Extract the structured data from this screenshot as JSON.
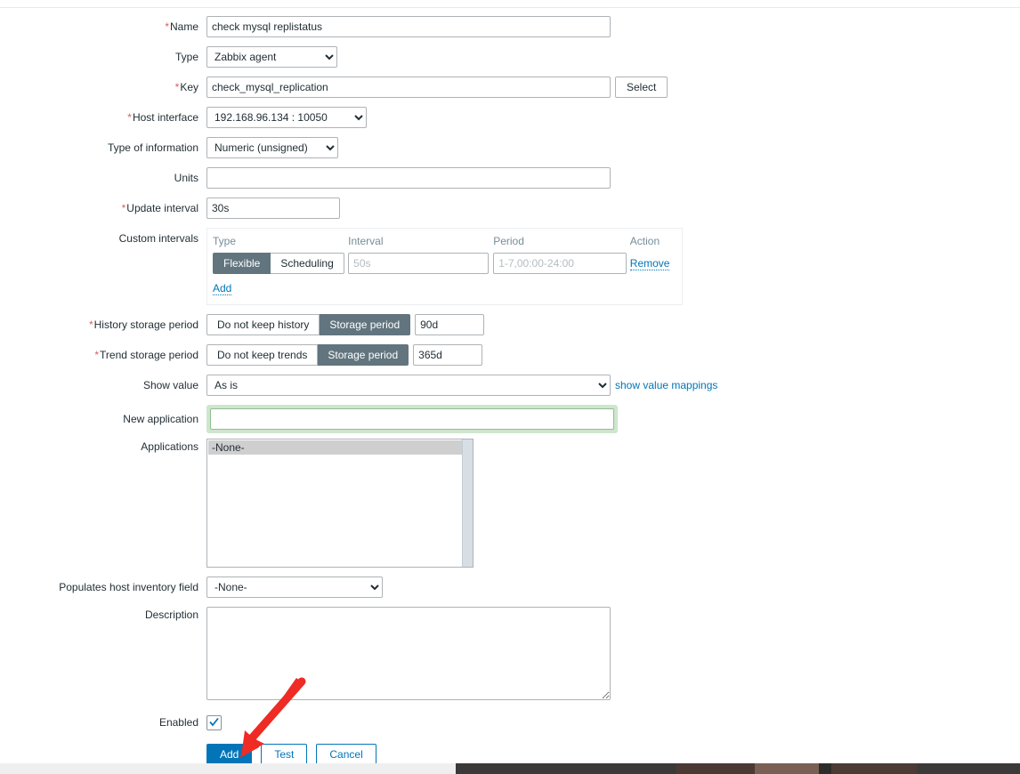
{
  "form": {
    "name": {
      "label": "Name",
      "required": true,
      "value": "check mysql replistatus"
    },
    "type": {
      "label": "Type",
      "required": false,
      "value": "Zabbix agent",
      "options": [
        "Zabbix agent"
      ]
    },
    "key": {
      "label": "Key",
      "required": true,
      "value": "check_mysql_replication",
      "select_button": "Select"
    },
    "host_interface": {
      "label": "Host interface",
      "required": true,
      "value": "192.168.96.134 : 10050",
      "options": [
        "192.168.96.134 : 10050"
      ]
    },
    "type_of_information": {
      "label": "Type of information",
      "required": false,
      "value": "Numeric (unsigned)",
      "options": [
        "Numeric (unsigned)"
      ]
    },
    "units": {
      "label": "Units",
      "required": false,
      "value": ""
    },
    "update_interval": {
      "label": "Update interval",
      "required": true,
      "value": "30s"
    },
    "custom_intervals": {
      "label": "Custom intervals",
      "columns": [
        "Type",
        "Interval",
        "Period",
        "Action"
      ],
      "rows": [
        {
          "type_flexible": "Flexible",
          "type_scheduling": "Scheduling",
          "type_selected": "Flexible",
          "interval_value": "",
          "interval_placeholder": "50s",
          "period_value": "",
          "period_placeholder": "1-7,00:00-24:00",
          "action": "Remove"
        }
      ],
      "add_label": "Add"
    },
    "history_storage_period": {
      "label": "History storage period",
      "required": true,
      "option_off": "Do not keep history",
      "option_on": "Storage period",
      "selected": "Storage period",
      "value": "90d"
    },
    "trend_storage_period": {
      "label": "Trend storage period",
      "required": true,
      "option_off": "Do not keep trends",
      "option_on": "Storage period",
      "selected": "Storage period",
      "value": "365d"
    },
    "show_value": {
      "label": "Show value",
      "required": false,
      "value": "As is",
      "options": [
        "As is"
      ],
      "link": "show value mappings"
    },
    "new_application": {
      "label": "New application",
      "required": false,
      "value": "",
      "focused": true
    },
    "applications": {
      "label": "Applications",
      "options": [
        "-None-"
      ],
      "selected": "-None-"
    },
    "populates_host_inventory_field": {
      "label": "Populates host inventory field",
      "required": false,
      "value": "-None-",
      "options": [
        "-None-"
      ]
    },
    "description": {
      "label": "Description",
      "value": ""
    },
    "enabled": {
      "label": "Enabled",
      "checked": true
    }
  },
  "actions": {
    "add": "Add",
    "test": "Test",
    "cancel": "Cancel"
  },
  "colors": {
    "accent": "#0275b8",
    "toggle_active": "#62757f",
    "required_star": "#d75f5f",
    "focus_glow": "#cfe5cf",
    "annotation_arrow": "#ee2b24"
  }
}
